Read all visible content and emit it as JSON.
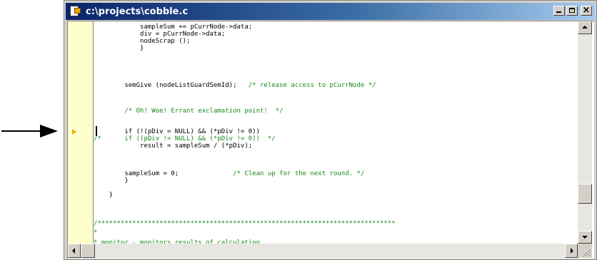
{
  "window": {
    "title": "c:\\projects\\cobble.c",
    "close_glyph": "×"
  },
  "icons": {
    "pointer": "arrow-right-icon",
    "app": "source-file-icon",
    "execution_marker": "execution-pointer-icon",
    "minimize": "minimize-icon",
    "maximize": "maximize-icon",
    "close": "close-icon"
  },
  "colors": {
    "titlebar_start": "#0a246a",
    "titlebar_end": "#a6caf0",
    "comment": "#1a8a1a",
    "gutter": "#ffffcc",
    "execution_marker": "#f0b000"
  },
  "editor": {
    "lines": [
      {
        "text": "            sampleSum += pCurrNode->data;",
        "kind": "code"
      },
      {
        "text": "            div = pCurrNode->data;",
        "kind": "code"
      },
      {
        "text": "            nodeScrap ();",
        "kind": "code"
      },
      {
        "text": "            }",
        "kind": "code"
      },
      {
        "text": "",
        "kind": "code"
      },
      {
        "text": "        semGive (nodeListGuardSemId);   /* release access to pCurrNode */",
        "kind": "mixed"
      },
      {
        "text": "",
        "kind": "code"
      },
      {
        "text": "",
        "kind": "code"
      },
      {
        "text": "        /* Oh! Woe! Errant exclamation point!  */",
        "kind": "comment"
      },
      {
        "text": "",
        "kind": "code"
      },
      {
        "text": "        if (!(pDiv = NULL) && (*pDiv != 0))",
        "kind": "code"
      },
      {
        "text": "/*      if ((pDiv != NULL) && (*pDiv != 0))  */",
        "kind": "comment"
      },
      {
        "text": "            result = sampleSum / (*pDiv);",
        "kind": "code"
      },
      {
        "text": "",
        "kind": "code"
      },
      {
        "text": "        sampleSum = 0;              /* Clean up for the next round. */",
        "kind": "mixed"
      },
      {
        "text": "        }",
        "kind": "code"
      },
      {
        "text": "    }",
        "kind": "code"
      },
      {
        "text": "",
        "kind": "code"
      },
      {
        "text": "",
        "kind": "code"
      },
      {
        "text": "/*****************************************************************************",
        "kind": "comment"
      },
      {
        "text": "*",
        "kind": "comment"
      },
      {
        "text": "* monitor - monitors results of calculation",
        "kind": "comment"
      }
    ]
  }
}
